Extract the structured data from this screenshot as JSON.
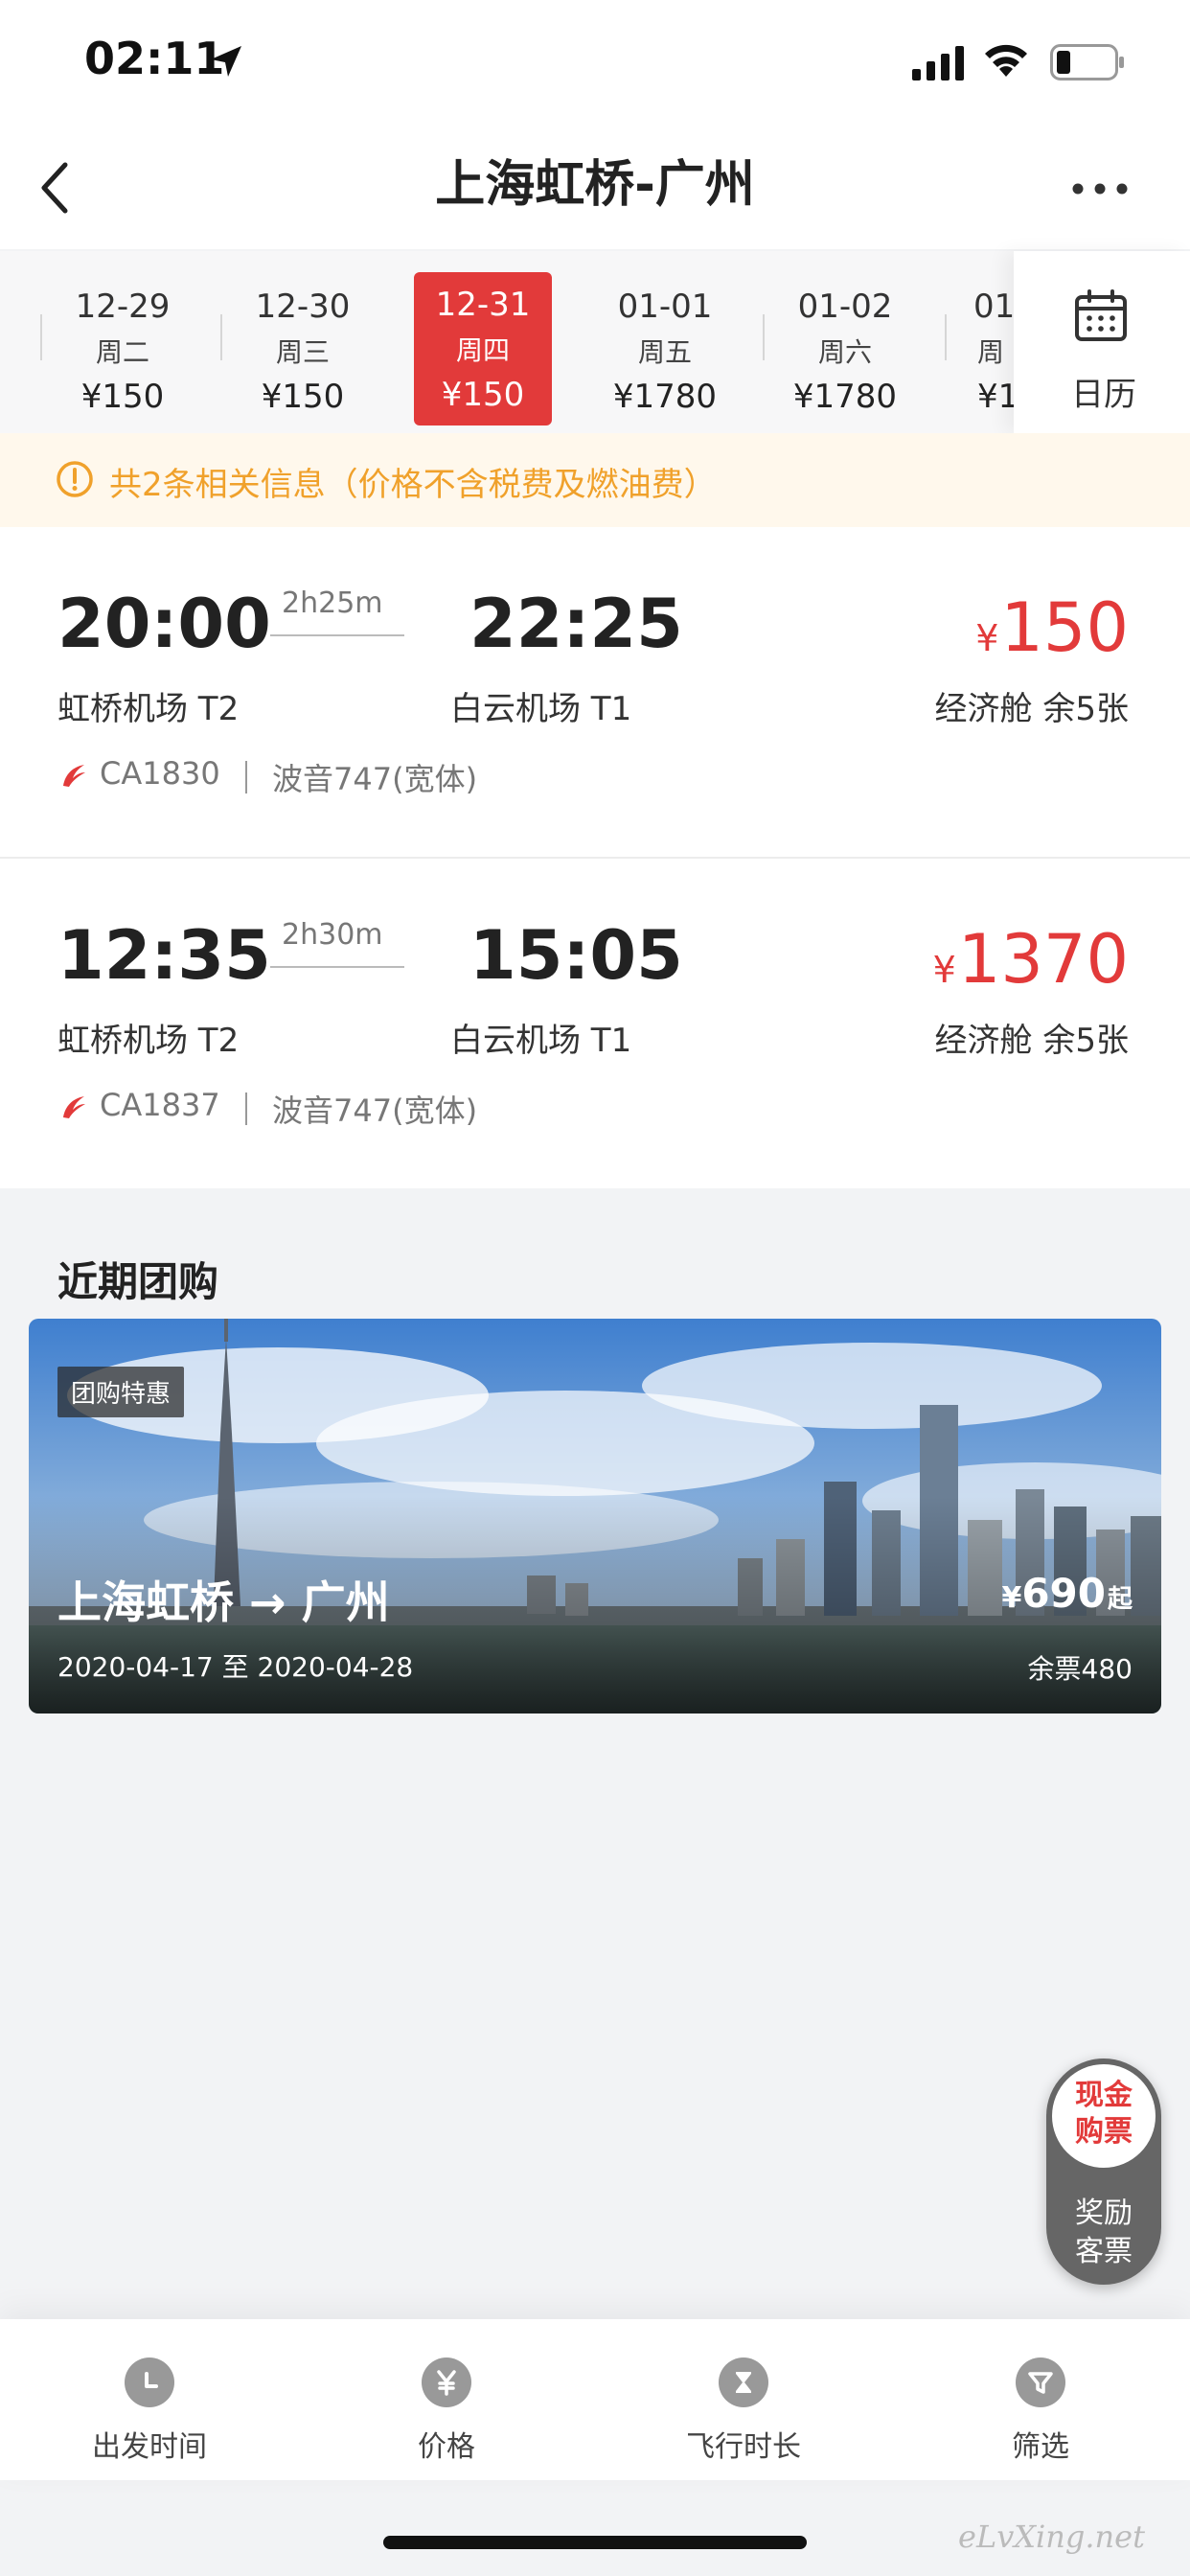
{
  "status": {
    "time": "02:11"
  },
  "nav": {
    "title": "上海虹桥-广州"
  },
  "dates": [
    {
      "date": "12-29",
      "weekday": "周二",
      "price": "¥150"
    },
    {
      "date": "12-30",
      "weekday": "周三",
      "price": "¥150"
    },
    {
      "date": "12-31",
      "weekday": "周四",
      "price": "¥150",
      "selected": true
    },
    {
      "date": "01-01",
      "weekday": "周五",
      "price": "¥1780"
    },
    {
      "date": "01-02",
      "weekday": "周六",
      "price": "¥1780"
    },
    {
      "date": "01-",
      "weekday": "周",
      "price": "¥1"
    }
  ],
  "calendar": {
    "label": "日历"
  },
  "notice": {
    "text": "共2条相关信息（价格不含税费及燃油费）"
  },
  "flights": [
    {
      "dep_time": "20:00",
      "duration": "2h25m",
      "arr_time": "22:25",
      "dep_airport": "虹桥机场 T2",
      "arr_airport": "白云机场 T1",
      "currency": "¥",
      "price": "150",
      "cabin": "经济舱 余5张",
      "flight_no": "CA1830",
      "aircraft": "波音747(宽体)"
    },
    {
      "dep_time": "12:35",
      "duration": "2h30m",
      "arr_time": "15:05",
      "dep_airport": "虹桥机场 T2",
      "arr_airport": "白云机场 T1",
      "currency": "¥",
      "price": "1370",
      "cabin": "经济舱 余5张",
      "flight_no": "CA1837",
      "aircraft": "波音747(宽体)"
    }
  ],
  "group": {
    "section_title": "近期团购",
    "tag": "团购特惠",
    "route": "上海虹桥 → 广州",
    "dates": "2020-04-17 至 2020-04-28",
    "currency": "¥",
    "price": "690",
    "price_suffix": "起",
    "stock": "余票480"
  },
  "floating": {
    "cash_line1": "现金",
    "cash_line2": "购票",
    "reward_line1": "奖励",
    "reward_line2": "客票"
  },
  "tabs": [
    {
      "label": "出发时间",
      "icon": "clock-icon"
    },
    {
      "label": "价格",
      "icon": "yen-icon"
    },
    {
      "label": "飞行时长",
      "icon": "hourglass-icon"
    },
    {
      "label": "筛选",
      "icon": "filter-icon"
    }
  ],
  "watermark": "eLvXing.net",
  "colors": {
    "accent": "#e23a3a",
    "notice": "#f0a12b",
    "notice_bg": "#fff8ec"
  }
}
